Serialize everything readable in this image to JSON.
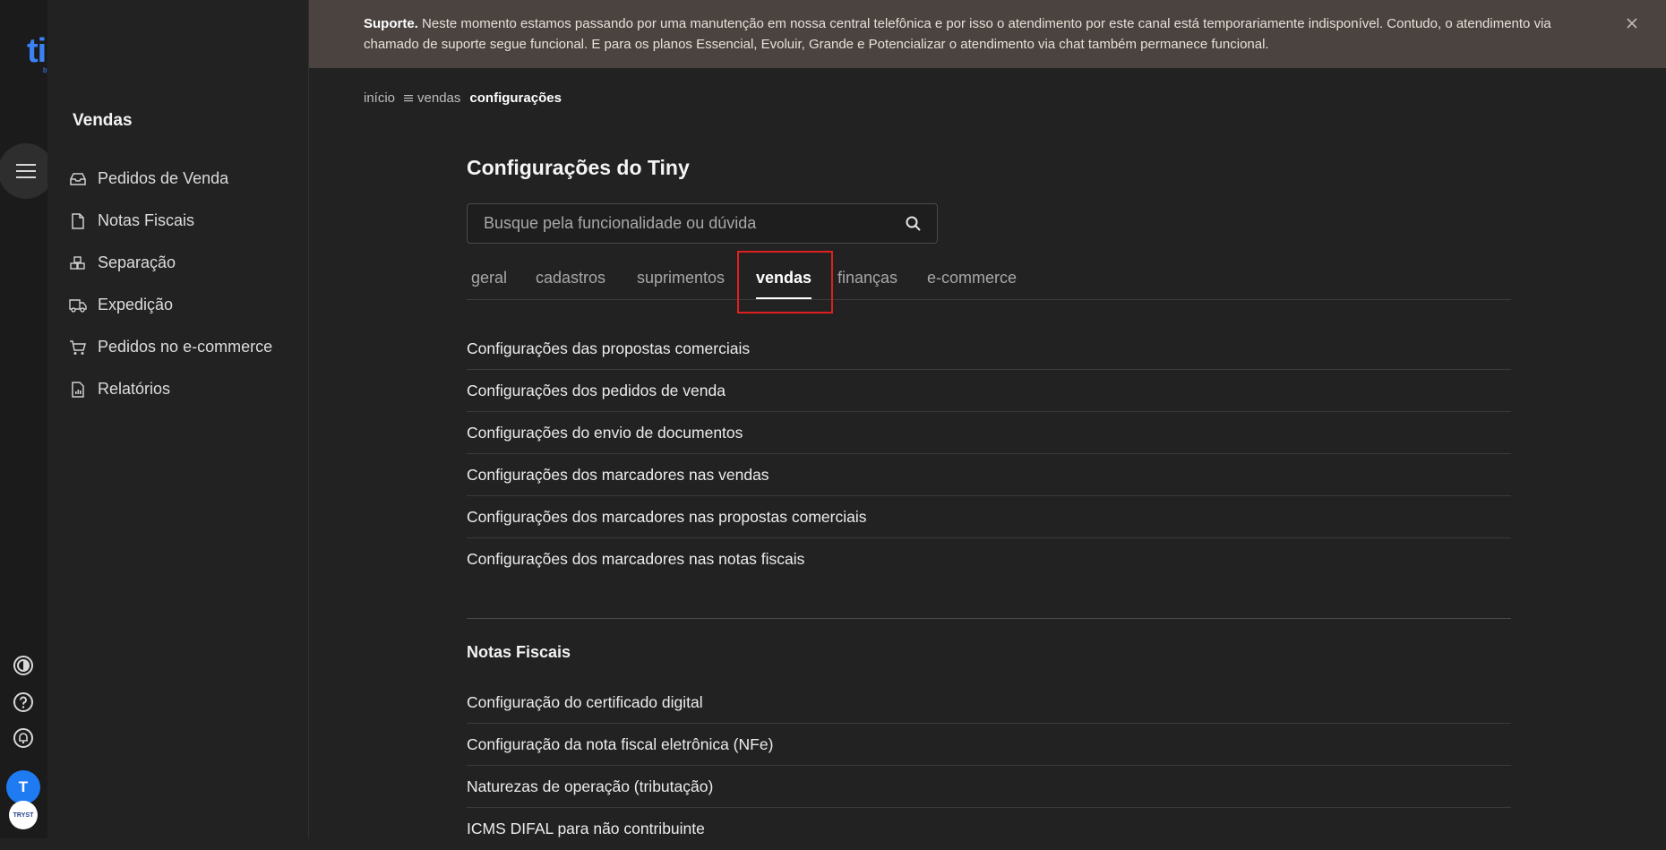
{
  "app": {
    "logo_text": "tiny",
    "logo_sub": "by olist"
  },
  "colors": {
    "accent": "#3b82f6",
    "highlight": "#e0201f",
    "banner_bg": "#4a433f",
    "avatar_bg": "#1f7bf2"
  },
  "rail": {
    "menu_icon": "hamburger-icon",
    "bottom_icons": [
      "theme-toggle-icon",
      "help-icon",
      "notification-bell-icon"
    ],
    "avatar_initial": "T",
    "account_badge": "TRYST"
  },
  "sidebar": {
    "title": "Vendas",
    "items": [
      {
        "label": "Pedidos de Venda",
        "icon": "inbox-icon"
      },
      {
        "label": "Notas Fiscais",
        "icon": "document-icon"
      },
      {
        "label": "Separação",
        "icon": "boxes-icon"
      },
      {
        "label": "Expedição",
        "icon": "truck-icon"
      },
      {
        "label": "Pedidos no e-commerce",
        "icon": "cart-icon"
      },
      {
        "label": "Relatórios",
        "icon": "report-icon"
      }
    ]
  },
  "banner": {
    "label": "Suporte.",
    "message": "Neste momento estamos passando por uma manutenção em nossa central telefônica e por isso o atendimento por este canal está temporariamente indisponível. Contudo, o atendimento via chamado de suporte segue funcional. E para os planos Essencial, Evoluir, Grande e Potencializar o atendimento via chat também permanece funcional.",
    "close_icon": "close-icon"
  },
  "breadcrumb": {
    "home": "início",
    "section": "vendas",
    "current": "configurações"
  },
  "page": {
    "title": "Configurações do Tiny"
  },
  "search": {
    "placeholder": "Busque pela funcionalidade ou dúvida",
    "value": ""
  },
  "tabs": [
    {
      "label": "geral",
      "active": false
    },
    {
      "label": "cadastros",
      "active": false
    },
    {
      "label": "suprimentos",
      "active": false
    },
    {
      "label": "vendas",
      "active": true
    },
    {
      "label": "finanças",
      "active": false
    },
    {
      "label": "e-commerce",
      "active": false
    }
  ],
  "sales_settings": [
    "Configurações das propostas comerciais",
    "Configurações dos pedidos de venda",
    "Configurações do envio de documentos",
    "Configurações dos marcadores nas vendas",
    "Configurações dos marcadores nas propostas comerciais",
    "Configurações dos marcadores nas notas fiscais"
  ],
  "invoices_section": {
    "title": "Notas Fiscais",
    "items": [
      "Configuração do certificado digital",
      "Configuração da nota fiscal eletrônica (NFe)",
      "Naturezas de operação (tributação)",
      "ICMS DIFAL para não contribuinte"
    ]
  }
}
